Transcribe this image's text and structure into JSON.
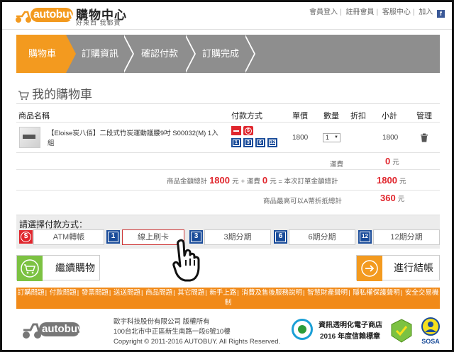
{
  "header": {
    "logo_text": "autobuy",
    "title": "購物中心",
    "subtitle": "好東西 我都賣",
    "links": [
      "會員登入",
      "註冊會員",
      "客服中心",
      "加入"
    ],
    "fb_icon": "f"
  },
  "steps": [
    "購物車",
    "訂購資訊",
    "確認付款",
    "訂購完成"
  ],
  "cart": {
    "title": "我的購物車",
    "headers": [
      "商品名稱",
      "付款方式",
      "單價",
      "數量",
      "折扣",
      "小計",
      "管理"
    ],
    "item": {
      "name": "【Eloise炭八佰】二段式竹炭運動護腰9吋 S00032(M) 1入組",
      "pay_icons": [
        "$",
        "1",
        "3",
        "6",
        "12"
      ],
      "price": "1800",
      "qty": "1",
      "discount": "",
      "subtotal": "1800"
    },
    "shipping": {
      "label": "運費",
      "value": "0",
      "unit": "元"
    },
    "total_line": {
      "label": "商品金額總計",
      "value": "1800",
      "unit": "元",
      "plus": "+ 運費",
      "ship": "0",
      "eq": "元 = 本次訂單金額總計",
      "grand": "1800",
      "grand_unit": "元"
    },
    "max_line": {
      "label": "商品最高可以A幣折抵總計",
      "value": "360",
      "unit": "元"
    }
  },
  "payment": {
    "label": "請選擇付款方式：",
    "options": [
      {
        "icon": "$",
        "label": "ATM轉帳"
      },
      {
        "icon": "1",
        "label": "線上刷卡"
      },
      {
        "icon": "3",
        "label": "3期分期"
      },
      {
        "icon": "6",
        "label": "6期分期"
      },
      {
        "icon": "12",
        "label": "12期分期"
      }
    ],
    "selected": "線上刷卡"
  },
  "actions": {
    "continue": "繼續購物",
    "checkout": "進行結帳"
  },
  "footer": {
    "links": [
      "訂購問題",
      "付款問題",
      "發票問題",
      "送送問題",
      "商品問題",
      "其它問題",
      "新手上路",
      "消費及售後服務說明",
      "智慧財產聲明",
      "隱私權保護聲明",
      "安全交易機制"
    ],
    "company_line1": "歐宇科技股份有限公司 版權所有",
    "company_line2": "100台北市中正區新生南路一段6號10樓",
    "company_line3": "Copyright © 2011-2016 AUTOBUY. All Rights Reserved.",
    "cert_line1": "資訊透明化電子商店",
    "cert_line2": "2016 年度信賴標章",
    "sosa": "SOSA",
    "colors": {
      "orange": "#f18a19",
      "step_active": "#f39a1f",
      "step_gray": "#8e8e8e",
      "red": "#e0262d",
      "blue": "#1a4c9a",
      "green": "#7cc242"
    }
  }
}
